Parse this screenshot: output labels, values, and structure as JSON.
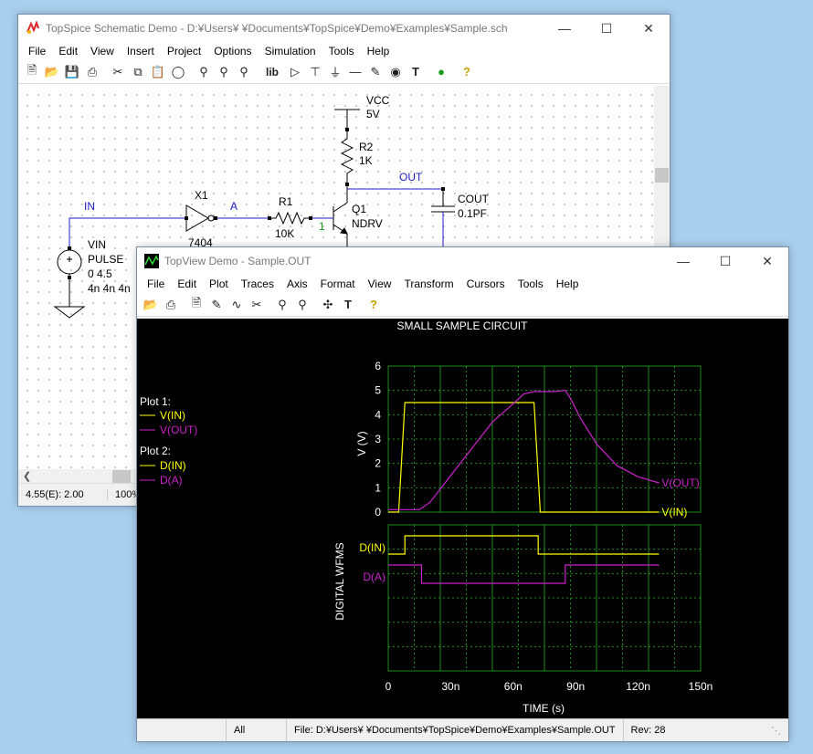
{
  "schematic": {
    "title": "TopSpice Schematic Demo - D:¥Users¥          ¥Documents¥TopSpice¥Demo¥Examples¥Sample.sch",
    "menu": [
      "File",
      "Edit",
      "View",
      "Insert",
      "Project",
      "Options",
      "Simulation",
      "Tools",
      "Help"
    ],
    "toolbar_lib": "lib",
    "labels": {
      "vcc": "VCC",
      "vcc_val": "5V",
      "r2": "R2",
      "r2_val": "1K",
      "out": "OUT",
      "cout": "COUT",
      "cout_val": "0.1PF",
      "in": "IN",
      "x1": "X1",
      "a": "A",
      "r1": "R1",
      "r1_val": "10K",
      "q1": "Q1",
      "q1_model": "NDRV",
      "pin1": "1",
      "x1_model": "7404",
      "vin": "VIN",
      "pulse": "PULSE",
      "pulse_args1": "0 4.5",
      "pulse_args2": "4n 4n 4n"
    },
    "status": {
      "coords": "4.55(E): 2.00",
      "zoom": "100%"
    }
  },
  "topview": {
    "title": "TopView Demo - Sample.OUT",
    "menu": [
      "File",
      "Edit",
      "Plot",
      "Traces",
      "Axis",
      "Format",
      "View",
      "Transform",
      "Cursors",
      "Tools",
      "Help"
    ],
    "legend": {
      "plot1": "Plot 1:",
      "plot1_items": [
        "V(IN)",
        "V(OUT)"
      ],
      "plot2": "Plot 2:",
      "plot2_items": [
        "D(IN)",
        "D(A)"
      ]
    },
    "status": {
      "mode": "All",
      "file": "File: D:¥Users¥          ¥Documents¥TopSpice¥Demo¥Examples¥Sample.OUT",
      "rev": "Rev: 28"
    },
    "colors": {
      "yellow": "#ffff00",
      "magenta": "#cc22cc",
      "grid": "#1f8a1f",
      "text": "#ffffff"
    }
  },
  "chart_data": [
    {
      "type": "line",
      "title": "SMALL SAMPLE CIRCUIT",
      "ylabel": "V  (V)",
      "xlabel": "",
      "xlim": [
        0,
        150
      ],
      "ylim": [
        0,
        6
      ],
      "yticks": [
        "0",
        "1",
        "2",
        "3",
        "4",
        "5",
        "6"
      ],
      "grid": true,
      "series": [
        {
          "name": "V(IN)",
          "color": "#ffff00",
          "x": [
            0,
            5,
            8,
            70,
            73,
            130
          ],
          "y": [
            0,
            0,
            4.5,
            4.5,
            0,
            0
          ]
        },
        {
          "name": "V(OUT)",
          "color": "#cc22cc",
          "x": [
            0,
            15,
            20,
            30,
            40,
            50,
            60,
            65,
            70,
            75,
            80,
            85,
            88,
            92,
            100,
            110,
            120,
            130
          ],
          "y": [
            0.1,
            0.1,
            0.4,
            1.5,
            2.6,
            3.7,
            4.45,
            4.85,
            4.95,
            4.95,
            4.95,
            5.0,
            4.6,
            3.9,
            2.8,
            1.9,
            1.45,
            1.2
          ]
        }
      ]
    },
    {
      "type": "line",
      "ylabel": "DIGITAL WFMS",
      "xlabel": "TIME  (s)",
      "xlim": [
        0,
        150
      ],
      "xticks": [
        "0",
        "30n",
        "60n",
        "90n",
        "120n",
        "150n"
      ],
      "grid": true,
      "series": [
        {
          "name": "D(IN)",
          "color": "#ffff00",
          "x": [
            0,
            8,
            8,
            72,
            72,
            130
          ],
          "level": [
            0,
            0,
            1,
            1,
            0,
            0
          ]
        },
        {
          "name": "D(A)",
          "color": "#cc22cc",
          "x": [
            0,
            16,
            16,
            85,
            85,
            130
          ],
          "level": [
            1,
            1,
            0,
            0,
            1,
            1
          ]
        }
      ]
    }
  ]
}
